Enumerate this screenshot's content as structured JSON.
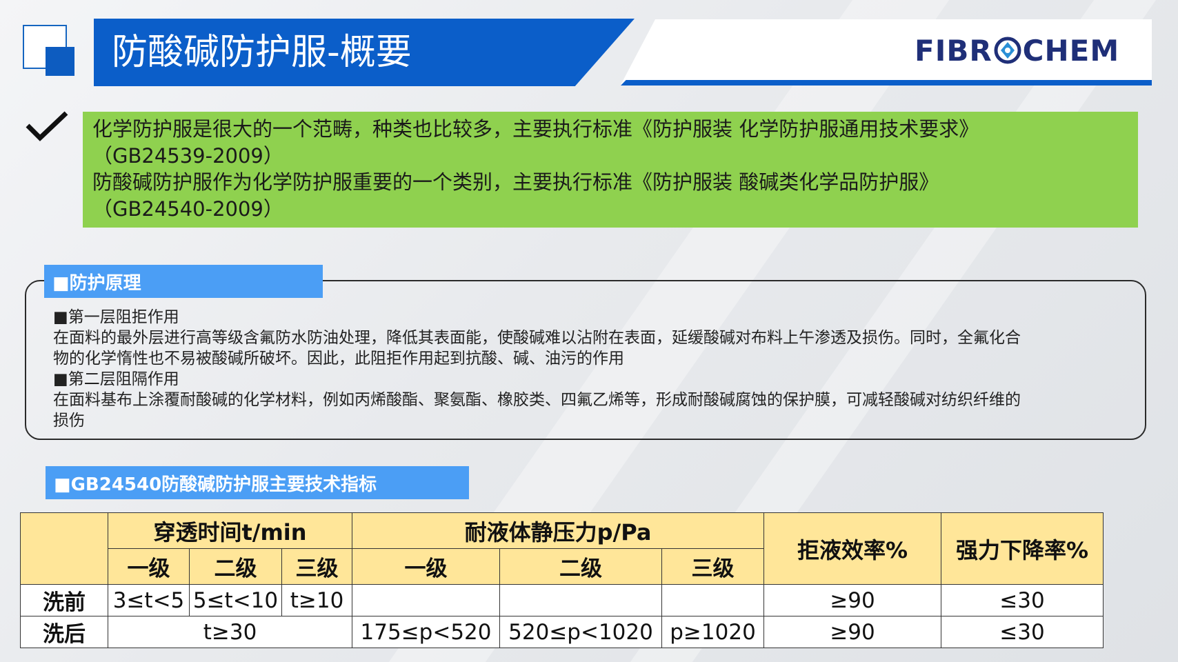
{
  "header": {
    "title": "防酸碱防护服-概要",
    "logo_left": "FIBR",
    "logo_right": "CHEM",
    "accent_color": "#0b5ec9"
  },
  "intro": {
    "lines": [
      "化学防护服是很大的一个范畴，种类也比较多，主要执行标准《防护服装 化学防护服通用技术要求》",
      "（GB24539-2009）",
      "防酸碱防护服作为化学防护服重要的一个类别，主要执行标准《防护服装 酸碱类化学品防护服》",
      "（GB24540-2009）"
    ],
    "background_color": "#8fd14f"
  },
  "principle": {
    "tag": "■防护原理",
    "paragraphs": [
      "■第一层阻拒作用",
      "在面料的最外层进行高等级含氟防水防油处理，降低其表面能，使酸碱难以沾附在表面，延缓酸碱对布料上午渗透及损伤。同时，全氟化合",
      "物的化学惰性也不易被酸碱所破坏。因此，此阻拒作用起到抗酸、碱、油污的作用",
      "■第二层阻隔作用",
      "在面料基布上涂覆耐酸碱的化学材料，例如丙烯酸酯、聚氨酯、橡胶类、四氟乙烯等，形成耐酸碱腐蚀的保护膜，可减轻酸碱对纺织纤维的",
      "损伤"
    ]
  },
  "spec": {
    "tag": "■GB24540防酸碱防护服主要技术指标",
    "header": {
      "penetration": "穿透时间t/min",
      "pressure": "耐液体静压力p/Pa",
      "repellency": "拒液效率%",
      "strength": "强力下降率%",
      "level1": "一级",
      "level2": "二级",
      "level3": "三级"
    },
    "rows": {
      "before": {
        "label": "洗前",
        "pen1": "3≤t<5",
        "pen2": "5≤t<10",
        "pen3": "t≥10",
        "pres1": "",
        "pres2": "",
        "pres3": "",
        "repellency": "≥90",
        "strength": "≤30"
      },
      "after": {
        "label": "洗后",
        "pen": "t≥30",
        "pres1": "175≤p<520",
        "pres2": "520≤p<1020",
        "pres3": "p≥1020",
        "repellency": "≥90",
        "strength": "≤30"
      }
    },
    "header_color": "#ffe699"
  }
}
